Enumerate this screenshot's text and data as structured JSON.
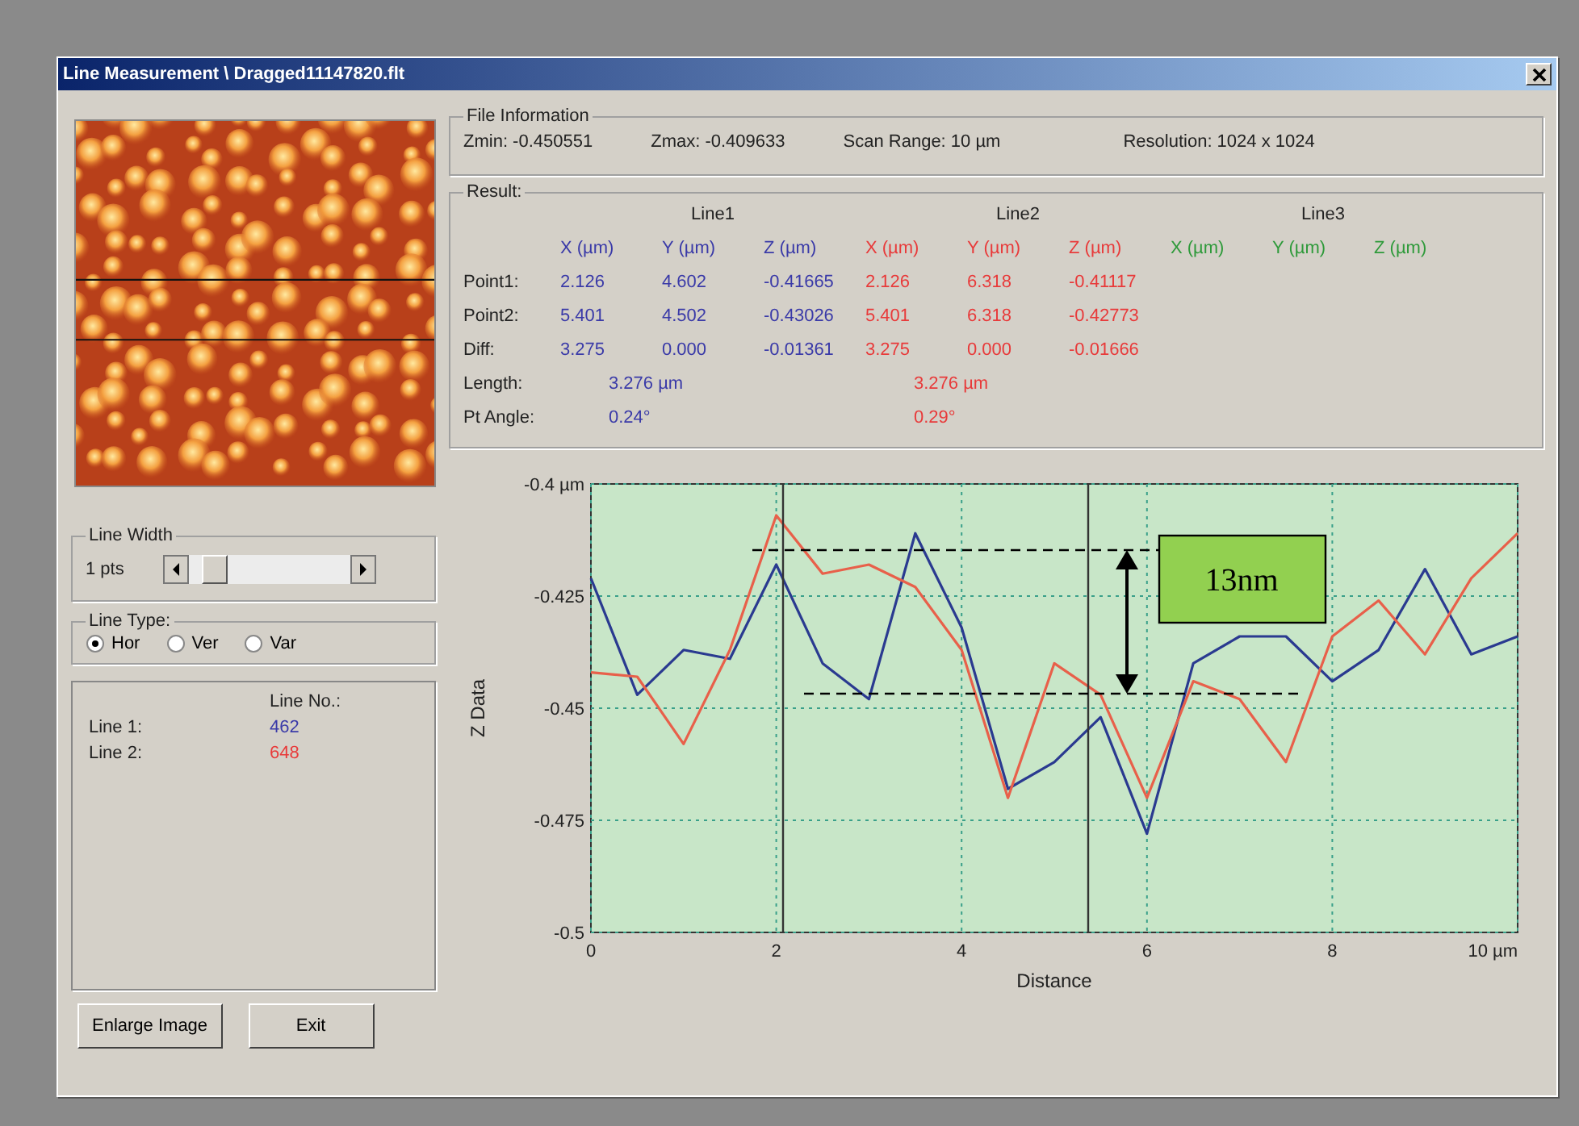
{
  "window": {
    "title": "Line Measurement \\ Dragged11147820.flt"
  },
  "line_width": {
    "label": "Line Width",
    "value": "1 pts",
    "level": 0.08
  },
  "line_type": {
    "label": "Line Type:",
    "options": [
      {
        "label": "Hor",
        "selected": true
      },
      {
        "label": "Ver",
        "selected": false
      },
      {
        "label": "Var",
        "selected": false
      }
    ]
  },
  "line_list": {
    "heading": "Line No.:",
    "lines": [
      {
        "label": "Line 1:",
        "number": "462",
        "color": "#3a3aa8"
      },
      {
        "label": "Line 2:",
        "number": "648",
        "color": "#e83a3a"
      }
    ]
  },
  "buttons": [
    "Enlarge Image",
    "Exit"
  ],
  "file_information": {
    "label": "File Information",
    "fields": [
      "Zmin: -0.450551",
      "Zmax: -0.409633",
      "Scan Range: 10 µm",
      "Resolution: 1024 x 1024"
    ]
  },
  "result": {
    "label": "Result:",
    "groups": [
      {
        "name": "Line1",
        "color": "#3a3aa8",
        "headers": [
          "X (µm)",
          "Y (µm)",
          "Z (µm)"
        ]
      },
      {
        "name": "Line2",
        "color": "#e83a3a",
        "headers": [
          "X (µm)",
          "Y (µm)",
          "Z (µm)"
        ]
      },
      {
        "name": "Line3",
        "color": "#2e9a3a",
        "headers": [
          "X (µm)",
          "Y (µm)",
          "Z (µm)"
        ]
      }
    ],
    "rows": [
      {
        "kind": "point",
        "label": "Point1:",
        "values": [
          [
            "2.126",
            "4.602",
            "-0.41665"
          ],
          [
            "2.126",
            "6.318",
            "-0.41117"
          ]
        ]
      },
      {
        "kind": "point",
        "label": "Point2:",
        "values": [
          [
            "5.401",
            "4.502",
            "-0.43026"
          ],
          [
            "5.401",
            "6.318",
            "-0.42773"
          ]
        ]
      },
      {
        "kind": "point",
        "label": "Diff:",
        "values": [
          [
            "3.275",
            "0.000",
            "-0.01361"
          ],
          [
            "3.275",
            "0.000",
            "-0.01666"
          ]
        ]
      },
      {
        "kind": "summary",
        "label": "Length:",
        "values": [
          "3.276 µm",
          "3.276 µm"
        ]
      },
      {
        "kind": "summary",
        "label": "Pt Angle:",
        "values": [
          "0.24°",
          "0.29°"
        ]
      }
    ]
  },
  "measurement": {
    "label": "13nm"
  },
  "chart_data": {
    "type": "line",
    "xlabel": "Distance",
    "ylabel": "Z Data",
    "grid": true,
    "x": [
      0,
      0.5,
      1,
      1.5,
      2,
      2.5,
      3,
      3.5,
      4,
      4.5,
      5,
      5.5,
      6,
      6.5,
      7,
      7.5,
      8,
      8.5,
      9,
      9.5,
      10
    ],
    "series": [
      {
        "color": "#2a3a90",
        "values": [
          -0.421,
          -0.447,
          -0.437,
          -0.439,
          -0.418,
          -0.44,
          -0.448,
          -0.411,
          -0.432,
          -0.468,
          -0.462,
          -0.452,
          -0.478,
          -0.44,
          -0.434,
          -0.434,
          -0.444,
          -0.437,
          -0.419,
          -0.438,
          -0.434
        ]
      },
      {
        "color": "#e8604a",
        "values": [
          -0.442,
          -0.443,
          -0.458,
          -0.437,
          -0.407,
          -0.42,
          -0.418,
          -0.423,
          -0.437,
          -0.47,
          -0.44,
          -0.447,
          -0.47,
          -0.444,
          -0.448,
          -0.462,
          -0.434,
          -0.426,
          -0.438,
          -0.421,
          -0.411
        ]
      }
    ],
    "xlim": [
      0,
      10
    ],
    "ylim": [
      -0.5,
      -0.4
    ],
    "xticks": [
      0,
      2,
      4,
      6,
      8,
      {
        "value": 10,
        "label": "10 µm"
      }
    ],
    "yticks": [
      {
        "value": -0.4,
        "label": "-0.4 µm"
      },
      -0.425,
      -0.45,
      -0.475,
      -0.5
    ]
  }
}
